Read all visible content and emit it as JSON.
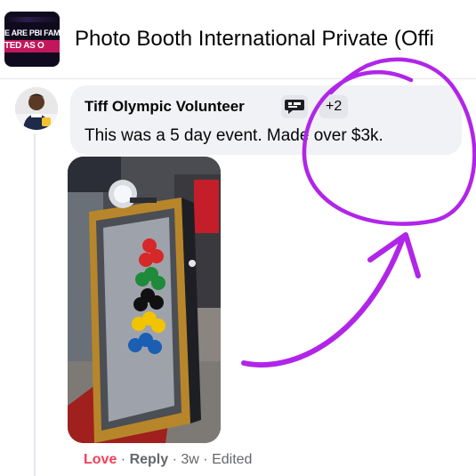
{
  "group": {
    "name": "Photo Booth International Private (Offi",
    "avatar_line1": "E ARE PBI FAMI",
    "avatar_line2": "TED AS O"
  },
  "comment": {
    "author": "Tiff Olympic Volunteer",
    "badge_icon": "chat-bubble-badge-icon",
    "badge_count": "+2",
    "text": "This was a 5 day event. Made over $3k.",
    "photo": "photo-booth-mirror-with-balloons"
  },
  "actions": {
    "love": "Love",
    "reply": "Reply",
    "time": "3w",
    "edited": "Edited",
    "separator": "·"
  },
  "colors": {
    "love": "#f33e58",
    "annotation": "#b026e8",
    "bubble": "#f0f2f5",
    "meta": "#65676b"
  },
  "annotation": {
    "circle": "circle-highlight-icon",
    "arrow": "curved-arrow-icon"
  }
}
